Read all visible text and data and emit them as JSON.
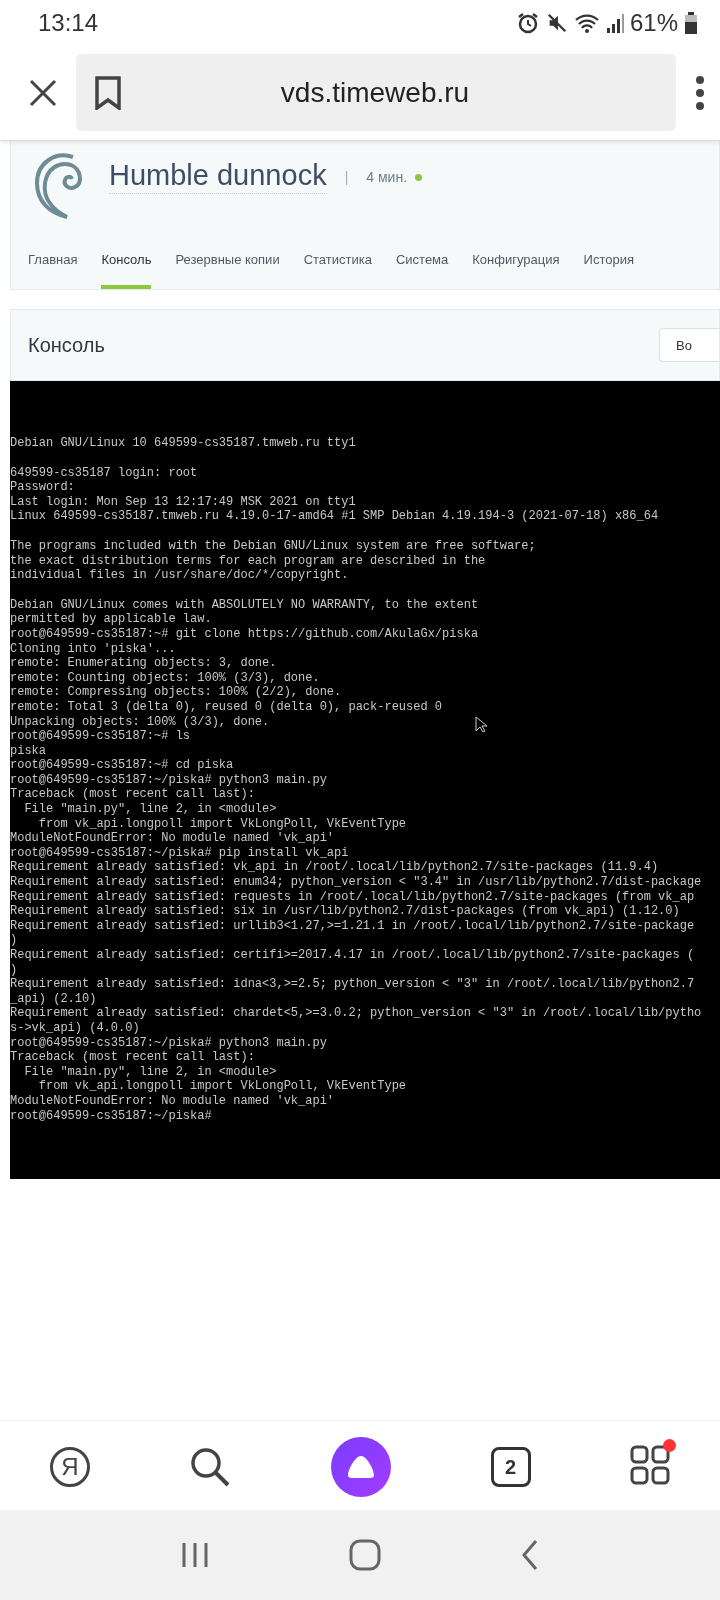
{
  "status_bar": {
    "time": "13:14",
    "battery": "61%"
  },
  "browser": {
    "url": "vds.timeweb.ru"
  },
  "server": {
    "name": "Humble dunnock",
    "separator": "|",
    "uptime": "4 мин.",
    "online": true
  },
  "tabs": [
    {
      "label": "Главная",
      "selected": false
    },
    {
      "label": "Консоль",
      "selected": true
    },
    {
      "label": "Резервные копии",
      "selected": false
    },
    {
      "label": "Статистика",
      "selected": false
    },
    {
      "label": "Система",
      "selected": false
    },
    {
      "label": "Конфигурация",
      "selected": false
    },
    {
      "label": "История",
      "selected": false
    }
  ],
  "console": {
    "title": "Консоль",
    "button": "Во",
    "blocks": [
      [
        "Debian GNU/Linux 10 649599-cs35187.tmweb.ru tty1"
      ],
      [
        "649599-cs35187 login: root",
        "Password:",
        "Last login: Mon Sep 13 12:17:49 MSK 2021 on tty1",
        "Linux 649599-cs35187.tmweb.ru 4.19.0-17-amd64 #1 SMP Debian 4.19.194-3 (2021-07-18) x86_64"
      ],
      [
        "The programs included with the Debian GNU/Linux system are free software;",
        "the exact distribution terms for each program are described in the",
        "individual files in /usr/share/doc/*/copyright."
      ],
      [
        "Debian GNU/Linux comes with ABSOLUTELY NO WARRANTY, to the extent",
        "permitted by applicable law.",
        "root@649599-cs35187:~# git clone https://github.com/AkulaGx/piska",
        "Cloning into 'piska'...",
        "remote: Enumerating objects: 3, done.",
        "remote: Counting objects: 100% (3/3), done.",
        "remote: Compressing objects: 100% (2/2), done.",
        "remote: Total 3 (delta 0), reused 0 (delta 0), pack-reused 0",
        "Unpacking objects: 100% (3/3), done.",
        "root@649599-cs35187:~# ls",
        "piska",
        "root@649599-cs35187:~# cd piska",
        "root@649599-cs35187:~/piska# python3 main.py",
        "Traceback (most recent call last):",
        "  File \"main.py\", line 2, in <module>",
        "    from vk_api.longpoll import VkLongPoll, VkEventType",
        "ModuleNotFoundError: No module named 'vk_api'",
        "root@649599-cs35187:~/piska# pip install vk_api",
        "Requirement already satisfied: vk_api in /root/.local/lib/python2.7/site-packages (11.9.4)",
        "Requirement already satisfied: enum34; python_version < \"3.4\" in /usr/lib/python2.7/dist-package",
        "Requirement already satisfied: requests in /root/.local/lib/python2.7/site-packages (from vk_ap",
        "Requirement already satisfied: six in /usr/lib/python2.7/dist-packages (from vk_api) (1.12.0)",
        "Requirement already satisfied: urllib3<1.27,>=1.21.1 in /root/.local/lib/python2.7/site-package",
        ")",
        "Requirement already satisfied: certifi>=2017.4.17 in /root/.local/lib/python2.7/site-packages (",
        ")",
        "Requirement already satisfied: idna<3,>=2.5; python_version < \"3\" in /root/.local/lib/python2.7",
        "_api) (2.10)",
        "Requirement already satisfied: chardet<5,>=3.0.2; python_version < \"3\" in /root/.local/lib/pytho",
        "s->vk_api) (4.0.0)",
        "root@649599-cs35187:~/piska# python3 main.py",
        "Traceback (most recent call last):",
        "  File \"main.py\", line 2, in <module>",
        "    from vk_api.longpoll import VkLongPoll, VkEventType",
        "ModuleNotFoundError: No module named 'vk_api'",
        "root@649599-cs35187:~/piska#"
      ]
    ]
  },
  "bottom_nav": {
    "logo_letter": "Я",
    "tab_count": "2",
    "notification": true
  }
}
